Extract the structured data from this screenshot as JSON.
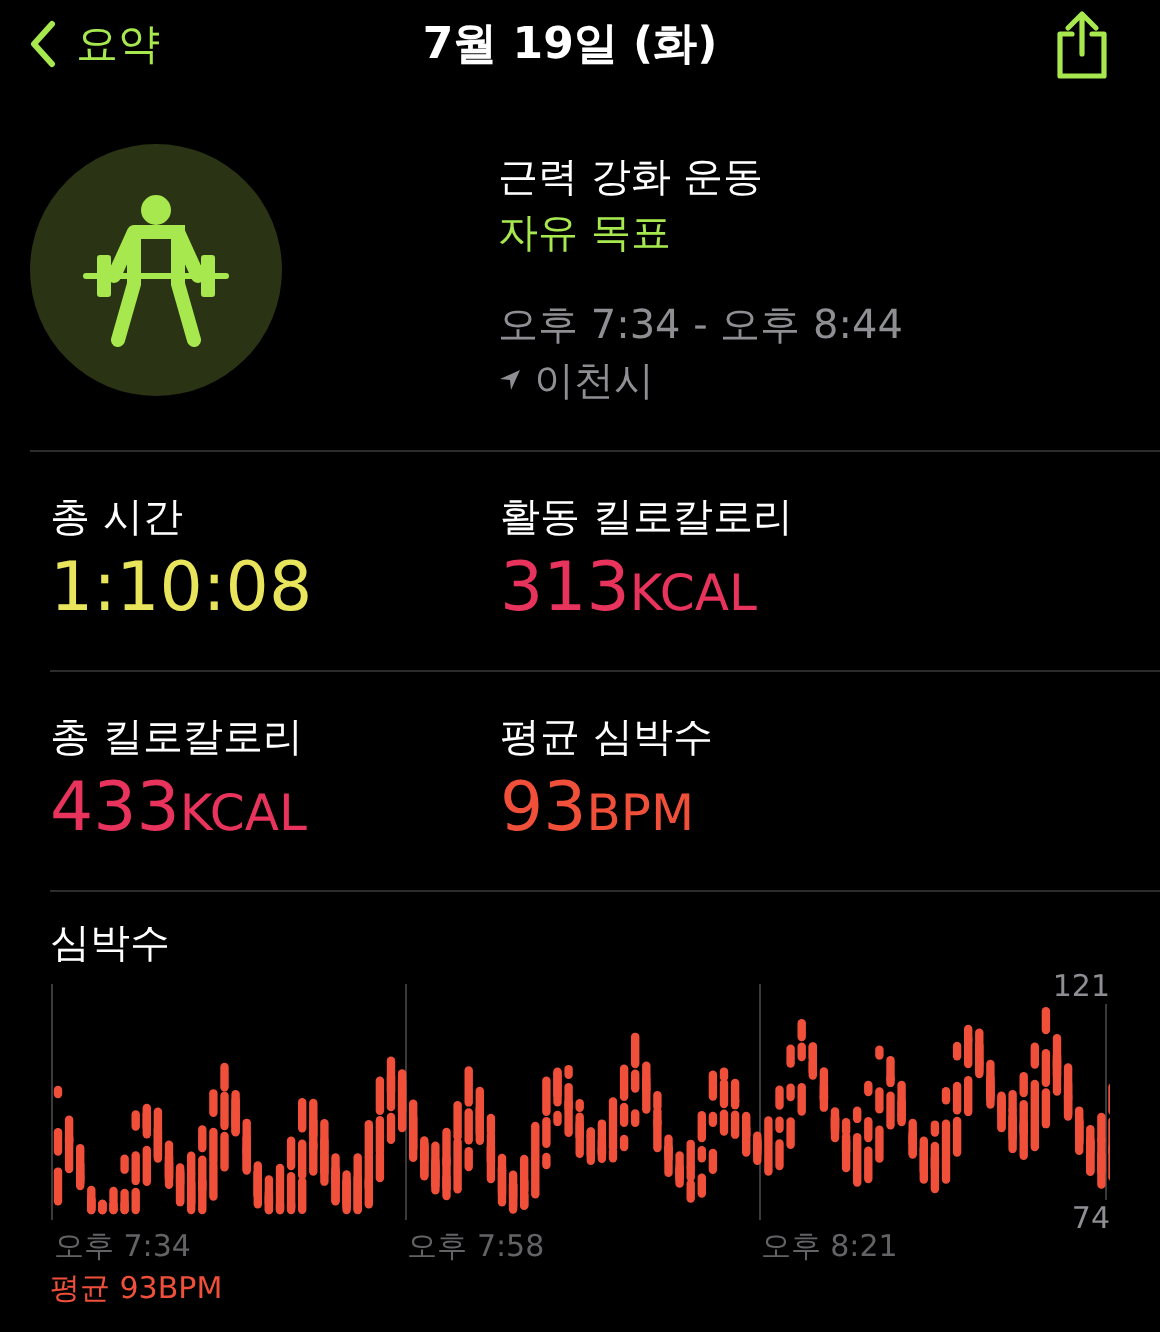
{
  "nav": {
    "back_label": "요약",
    "title": "7월 19일 (화)"
  },
  "workout": {
    "name": "근력 강화 운동",
    "goal": "자유 목표",
    "time_range": "오후 7:34 - 오후 8:44",
    "location": "이천시"
  },
  "stats": [
    {
      "label": "총 시간",
      "value": "1:10:08",
      "color": "#e8e45c"
    },
    {
      "label": "활동 킬로칼로리",
      "value": "313",
      "unit": "KCAL",
      "color": "#e8335c"
    },
    {
      "label": "총 킬로칼로리",
      "value": "433",
      "unit": "KCAL",
      "color": "#e8335c"
    },
    {
      "label": "평균 심박수",
      "value": "93",
      "unit": "BPM",
      "color": "#f0503a"
    }
  ],
  "heart_rate": {
    "title": "심박수",
    "max_label": "121",
    "min_label": "74",
    "time_labels": [
      "오후 7:34",
      "오후 7:58",
      "오후 8:21"
    ],
    "average": "평균 93BPM"
  }
}
